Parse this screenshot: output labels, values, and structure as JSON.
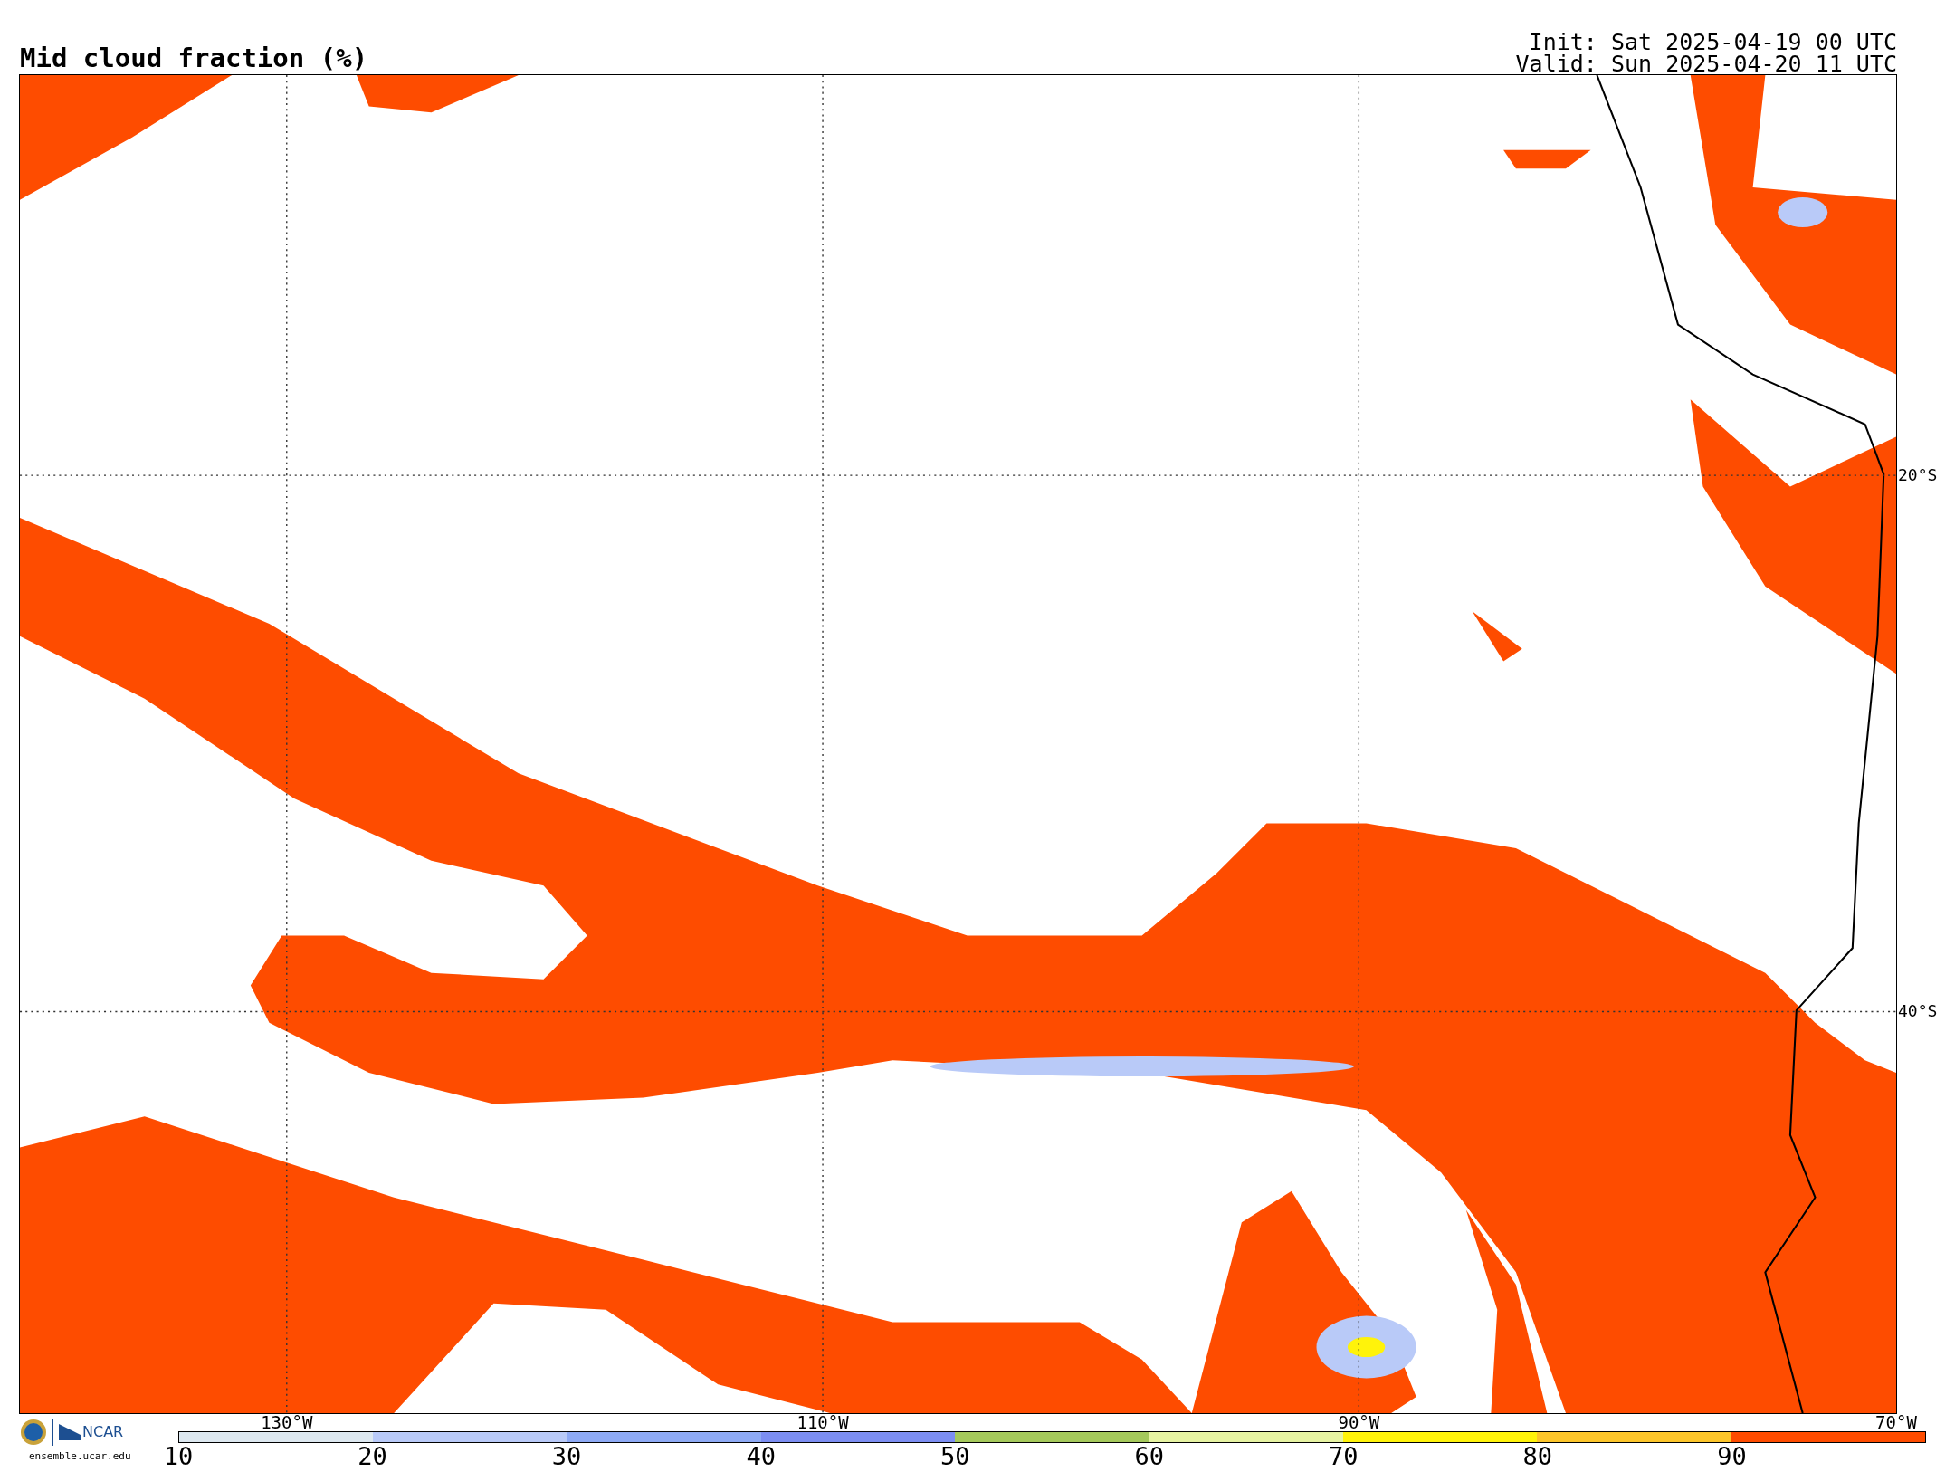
{
  "title": "Mid cloud fraction (%)",
  "init": "Init: Sat 2025-04-19 00 UTC",
  "valid": "Valid: Sun 2025-04-20 11 UTC",
  "map": {
    "lat_labels": [
      {
        "label": "20°S"
      },
      {
        "label": "40°S"
      }
    ],
    "lon_labels": [
      {
        "label": "130°W"
      },
      {
        "label": "110°W"
      },
      {
        "label": "90°W"
      },
      {
        "label": "70°W"
      }
    ]
  },
  "colorbar": {
    "bins": [
      {
        "color": "#dde8f0"
      },
      {
        "color": "#b9caf8"
      },
      {
        "color": "#8eaaf5"
      },
      {
        "color": "#7c8ef2"
      },
      {
        "color": "#a5c95c"
      },
      {
        "color": "#e6f3a2"
      },
      {
        "color": "#fff30a"
      },
      {
        "color": "#fcc52a"
      },
      {
        "color": "#fe4c00"
      }
    ],
    "ticks": [
      "10",
      "20",
      "30",
      "40",
      "50",
      "60",
      "70",
      "80",
      "90"
    ]
  },
  "logos": {
    "ncar": "NCAR",
    "site": "ensemble.ucar.edu"
  }
}
